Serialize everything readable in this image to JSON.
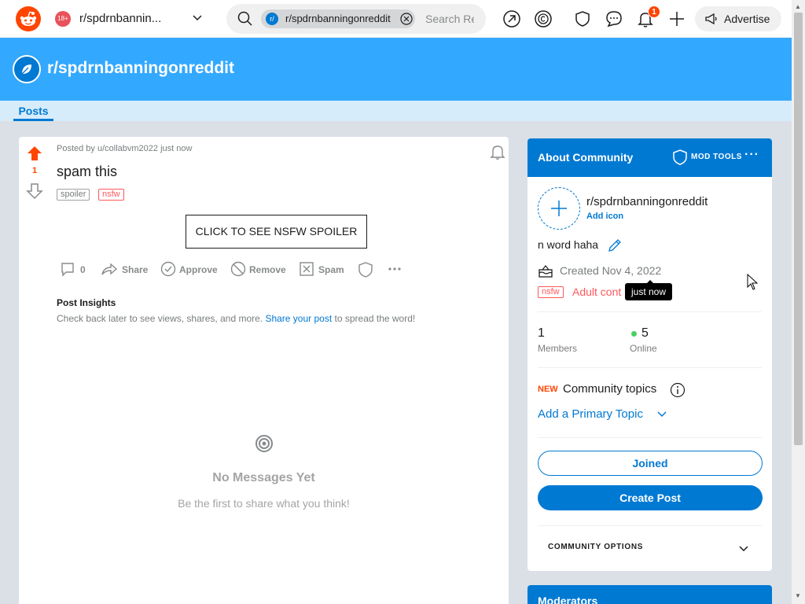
{
  "topbar": {
    "community_avatar_text": "18+",
    "community_name": "r/spdrnbannin...",
    "search_chip": "r/spdrnbanningonreddit",
    "search_chip_prefix": "r/",
    "search_placeholder": "Search Reddit",
    "notification_count": "1",
    "advertise_label": "Advertise"
  },
  "banner": {
    "title": "r/spdrnbanningonreddit"
  },
  "tabs": {
    "posts": "Posts"
  },
  "post": {
    "vote_count": "1",
    "meta": "Posted by u/collabvm2022 just now",
    "title": "spam this",
    "tag_spoiler": "spoiler",
    "tag_nsfw": "nsfw",
    "nsfw_button": "CLICK TO SEE NSFW SPOILER",
    "actions": {
      "comments": "0",
      "share": "Share",
      "approve": "Approve",
      "remove": "Remove",
      "spam": "Spam"
    },
    "insights_title": "Post Insights",
    "insights_text_before": "Check back later to see views, shares, and more. ",
    "insights_link": "Share your post",
    "insights_text_after": " to spread the word!",
    "no_messages_title": "No Messages Yet",
    "no_messages_sub": "Be the first to share what you think!"
  },
  "about": {
    "title": "About Community",
    "mod_tools": "MOD TOOLS",
    "name": "r/spdrnbanningonreddit",
    "add_icon": "Add icon",
    "description": "n word haha",
    "created": "Created Nov 4, 2022",
    "tag_nsfw": "nsfw",
    "adult_content": "Adult cont",
    "tooltip": "just now",
    "members_count": "1",
    "members_label": "Members",
    "online_count": "5",
    "online_label": "Online",
    "new_label": "NEW",
    "community_topics": "Community topics",
    "add_primary_topic": "Add a Primary Topic",
    "joined_button": "Joined",
    "create_post_button": "Create Post",
    "community_options": "COMMUNITY OPTIONS"
  },
  "moderators": {
    "title": "Moderators"
  },
  "colors": {
    "brand": "#ff4500",
    "primary": "#0079d3",
    "banner": "#33a8ff",
    "nsfw": "#ff585b",
    "online": "#46d160"
  }
}
